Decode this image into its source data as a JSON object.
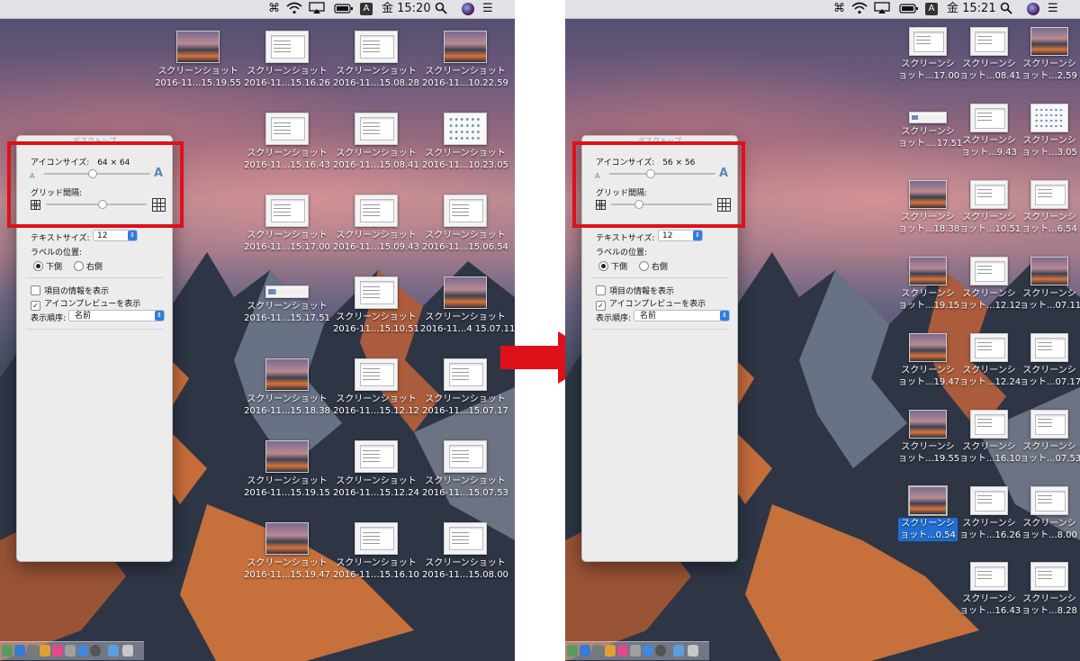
{
  "before": {
    "menubar": {
      "cmd_label": "⌘",
      "input_label": "A",
      "clock": "金 15:20",
      "search_icon": "search-icon",
      "list_icon": "☰"
    },
    "view_options": {
      "window_title": "デスクトップ",
      "icon_size_label": "アイコンサイズ:",
      "icon_size_value": "64 × 64",
      "icon_size_fraction": 0.45,
      "grid_spacing_label": "グリッド間隔:",
      "grid_spacing_fraction": 0.55,
      "text_size_label": "テキストサイズ:",
      "text_size_value": "12",
      "label_position_label": "ラベルの位置:",
      "position_bottom": "下側",
      "position_right": "右側",
      "show_item_info": "項目の情報を表示",
      "show_icon_preview": "アイコンプレビューを表示",
      "sort_by_label": "表示順序:",
      "sort_by_value": "名前"
    },
    "icons": [
      {
        "line1": "スクリーンショット",
        "line2": "2016-11...15.19.55",
        "kind": "t-mtn"
      },
      {
        "line1": "スクリーンショット",
        "line2": "2016-11...15.16.26",
        "kind": "t-doc"
      },
      {
        "line1": "スクリーンショット",
        "line2": "2016-11...15.08.28",
        "kind": "t-doc"
      },
      {
        "line1": "スクリーンショット",
        "line2": "2016-11...10.22.59",
        "kind": "t-mtn"
      },
      {
        "line1": "スクリーンショット",
        "line2": "2016-11...15.16.43",
        "kind": "t-doc"
      },
      {
        "line1": "スクリーンショット",
        "line2": "2016-11...15.08.41",
        "kind": "t-doc"
      },
      {
        "line1": "スクリーンショット",
        "line2": "2016-11...10.23.05",
        "kind": "t-grid"
      },
      {
        "line1": "スクリーンショット",
        "line2": "2016-11...15.17.00",
        "kind": "t-doc"
      },
      {
        "line1": "スクリーンショット",
        "line2": "2016-11...15.09.43",
        "kind": "t-doc"
      },
      {
        "line1": "スクリーンショット",
        "line2": "2016-11...15.06.54",
        "kind": "t-doc"
      },
      {
        "line1": "スクリーンショット",
        "line2": "2016-11...15.17.51",
        "kind": "t-wide"
      },
      {
        "line1": "スクリーンショット",
        "line2": "2016-11...15.10.51",
        "kind": "t-doc"
      },
      {
        "line1": "スクリーンショット",
        "line2": "2016-11...4 15.07.11",
        "kind": "t-mtn"
      },
      {
        "line1": "スクリーンショット",
        "line2": "2016-11...15.18.38",
        "kind": "t-mtn"
      },
      {
        "line1": "スクリーンショット",
        "line2": "2016-11...15.12.12",
        "kind": "t-doc"
      },
      {
        "line1": "スクリーンショット",
        "line2": "2016-11...15.07.17",
        "kind": "t-doc"
      },
      {
        "line1": "スクリーンショット",
        "line2": "2016-11...15.19.15",
        "kind": "t-mtn"
      },
      {
        "line1": "スクリーンショット",
        "line2": "2016-11...15.12.24",
        "kind": "t-doc"
      },
      {
        "line1": "スクリーンショット",
        "line2": "2016-11...15.07.53",
        "kind": "t-doc"
      },
      {
        "line1": "スクリーンショット",
        "line2": "2016-11...15.19.47",
        "kind": "t-mtn"
      },
      {
        "line1": "スクリーンショット",
        "line2": "2016-11...15.16.10",
        "kind": "t-doc"
      },
      {
        "line1": "スクリーンショット",
        "line2": "2016-11...15.08.00",
        "kind": "t-doc"
      }
    ]
  },
  "after": {
    "menubar": {
      "cmd_label": "⌘",
      "input_label": "A",
      "clock": "金 15:21",
      "search_icon": "search-icon",
      "list_icon": "☰"
    },
    "view_options": {
      "window_title": "デスクトップ",
      "icon_size_label": "アイコンサイズ:",
      "icon_size_value": "56 × 56",
      "icon_size_fraction": 0.38,
      "grid_spacing_label": "グリッド間隔:",
      "grid_spacing_fraction": 0.27,
      "text_size_label": "テキストサイズ:",
      "text_size_value": "12",
      "label_position_label": "ラベルの位置:",
      "position_bottom": "下側",
      "position_right": "右側",
      "show_item_info": "項目の情報を表示",
      "show_icon_preview": "アイコンプレビューを表示",
      "sort_by_label": "表示順序:",
      "sort_by_value": "名前"
    },
    "icons": [
      {
        "line1": "スクリーンシ",
        "line2": "ョット...17.00",
        "kind": "t-doc"
      },
      {
        "line1": "スクリーンシ",
        "line2": "ョット...08.41",
        "kind": "t-doc"
      },
      {
        "line1": "スクリーンシ",
        "line2": "ョット...2.59",
        "kind": "t-mtn"
      },
      {
        "line1": "スクリーンシ",
        "line2": "ョット....17.51",
        "kind": "t-wide"
      },
      {
        "line1": "スクリーンシ",
        "line2": "ョット...9.43",
        "kind": "t-doc"
      },
      {
        "line1": "スクリーンシ",
        "line2": "ョット...3.05",
        "kind": "t-grid"
      },
      {
        "line1": "スクリーンシ",
        "line2": "ョット...18.38",
        "kind": "t-mtn"
      },
      {
        "line1": "スクリーンシ",
        "line2": "ョット...10.51",
        "kind": "t-doc"
      },
      {
        "line1": "スクリーンシ",
        "line2": "ョット...6.54",
        "kind": "t-doc"
      },
      {
        "line1": "スクリーンシ",
        "line2": "ョット...19.15",
        "kind": "t-mtn"
      },
      {
        "line1": "スクリーンシ",
        "line2": "ョット...12.12",
        "kind": "t-doc"
      },
      {
        "line1": "スクリーンシ",
        "line2": "ョット...07.11",
        "kind": "t-mtn"
      },
      {
        "line1": "スクリーンシ",
        "line2": "ョット...19.47",
        "kind": "t-mtn"
      },
      {
        "line1": "スクリーンシ",
        "line2": "ョット...12.24",
        "kind": "t-doc"
      },
      {
        "line1": "スクリーンシ",
        "line2": "ョット...07.17",
        "kind": "t-doc"
      },
      {
        "line1": "スクリーンシ",
        "line2": "ョット...19.55",
        "kind": "t-mtn"
      },
      {
        "line1": "スクリーンシ",
        "line2": "ョット...16.10",
        "kind": "t-doc"
      },
      {
        "line1": "スクリーンシ",
        "line2": "ョット...07.53",
        "kind": "t-doc"
      },
      {
        "line1": "スクリーンシ",
        "line2": "ョット...0.54",
        "kind": "t-mtn",
        "selected": true
      },
      {
        "line1": "スクリーンシ",
        "line2": "ョット...16.26",
        "kind": "t-doc"
      },
      {
        "line1": "スクリーンシ",
        "line2": "ョット...8.00",
        "kind": "t-doc"
      },
      {
        "line1": "スクリーンシ",
        "line2": "ョット...16.43",
        "kind": "t-doc"
      },
      {
        "line1": "スクリーンシ",
        "line2": "ョット...8.28",
        "kind": "t-doc"
      }
    ]
  },
  "colors": {
    "highlight_box": "#e0101a",
    "arrow": "#e0101a",
    "selection": "#1f6fd6",
    "control_accent": "#2f7ce0"
  },
  "icons_semantic": [
    "wifi-icon",
    "airplay-icon",
    "battery-icon",
    "search-icon",
    "siri-icon",
    "notification-list-icon",
    "trash-icon",
    "folder-icon",
    "finder-icon"
  ]
}
